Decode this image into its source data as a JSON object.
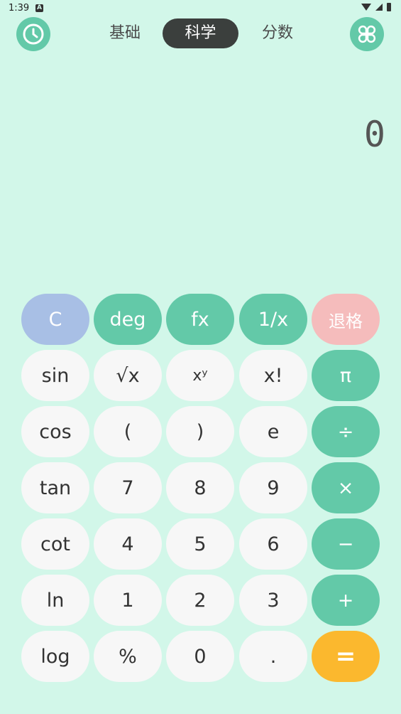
{
  "status": {
    "time": "1:39",
    "notif_icon": "A"
  },
  "toolbar": {
    "history_icon": "clock-icon",
    "menu_icon": "clover-icon"
  },
  "tabs": {
    "basic": "基础",
    "scientific": "科学",
    "fraction": "分数"
  },
  "display": {
    "value": "0"
  },
  "keys": {
    "clear": "C",
    "deg": "deg",
    "fx": "fx",
    "reciprocal": "1/x",
    "backspace": "退格",
    "sin": "sin",
    "sqrt": "√x",
    "power": "xʸ",
    "factorial": "x!",
    "pi": "π",
    "cos": "cos",
    "lparen": "(",
    "rparen": ")",
    "e": "e",
    "divide": "÷",
    "tan": "tan",
    "seven": "7",
    "eight": "8",
    "nine": "9",
    "multiply": "×",
    "cot": "cot",
    "four": "4",
    "five": "5",
    "six": "6",
    "minus": "−",
    "ln": "ln",
    "one": "1",
    "two": "2",
    "three": "3",
    "plus": "+",
    "log": "log",
    "percent": "%",
    "zero": "0",
    "dot": ".",
    "equals": "="
  },
  "colors": {
    "background": "#d2f7e9",
    "accent": "#63c9a8",
    "clear": "#a8bfe5",
    "backspace": "#f5bcbc",
    "equals": "#fbb82e",
    "active_tab": "#3b3f3d"
  }
}
